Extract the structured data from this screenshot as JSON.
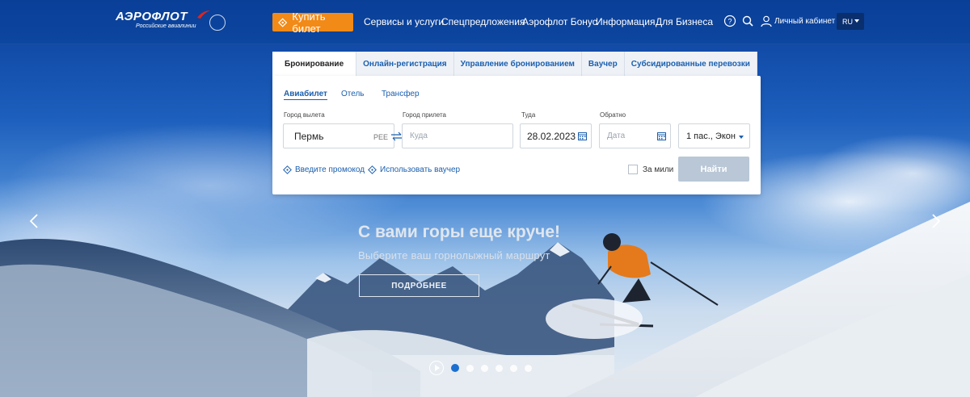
{
  "header": {
    "logo_text": "АЭРОФЛОТ",
    "logo_sub": "Российские авиалинии",
    "buy_label": "Купить билет",
    "nav": [
      "Сервисы и услуги",
      "Спецпредложения",
      "Аэрофлот Бонус",
      "Информация",
      "Для Бизнеса"
    ],
    "cabinet_label": "Личный кабинет",
    "lang": "RU",
    "icons": [
      "help-icon",
      "search-icon",
      "user-icon"
    ]
  },
  "booking": {
    "tabs": [
      "Бронирование",
      "Онлайн-регистрация",
      "Управление бронированием",
      "Ваучер",
      "Субсидированные перевозки"
    ],
    "active_tab": "Бронирование",
    "subtabs": [
      "Авиабилет",
      "Отель",
      "Трансфер"
    ],
    "active_subtab": "Авиабилет",
    "from_label": "Город вылета",
    "from_value": "Пермь",
    "from_code": "PEE",
    "to_label": "Город прилета",
    "to_placeholder": "Куда",
    "depart_label": "Туда",
    "depart_value": "28.02.2023",
    "return_label": "Обратно",
    "return_placeholder": "Дата",
    "pax_value": "1 пас., Экон",
    "promo_label": "Введите промокод",
    "voucher_label": "Использовать ваучер",
    "miles_label": "За мили",
    "search_label": "Найти"
  },
  "hero": {
    "title": "С вами горы еще круче!",
    "subtitle": "Выберите ваш горнолыжный маршрут",
    "more_label": "ПОДРОБНЕЕ",
    "slides_total": 6,
    "active_slide": 1
  },
  "colors": {
    "brand_blue": "#0c469f",
    "accent_orange": "#f28a17",
    "link_blue": "#1b5fae",
    "disabled_button": "#b9c7d6"
  }
}
